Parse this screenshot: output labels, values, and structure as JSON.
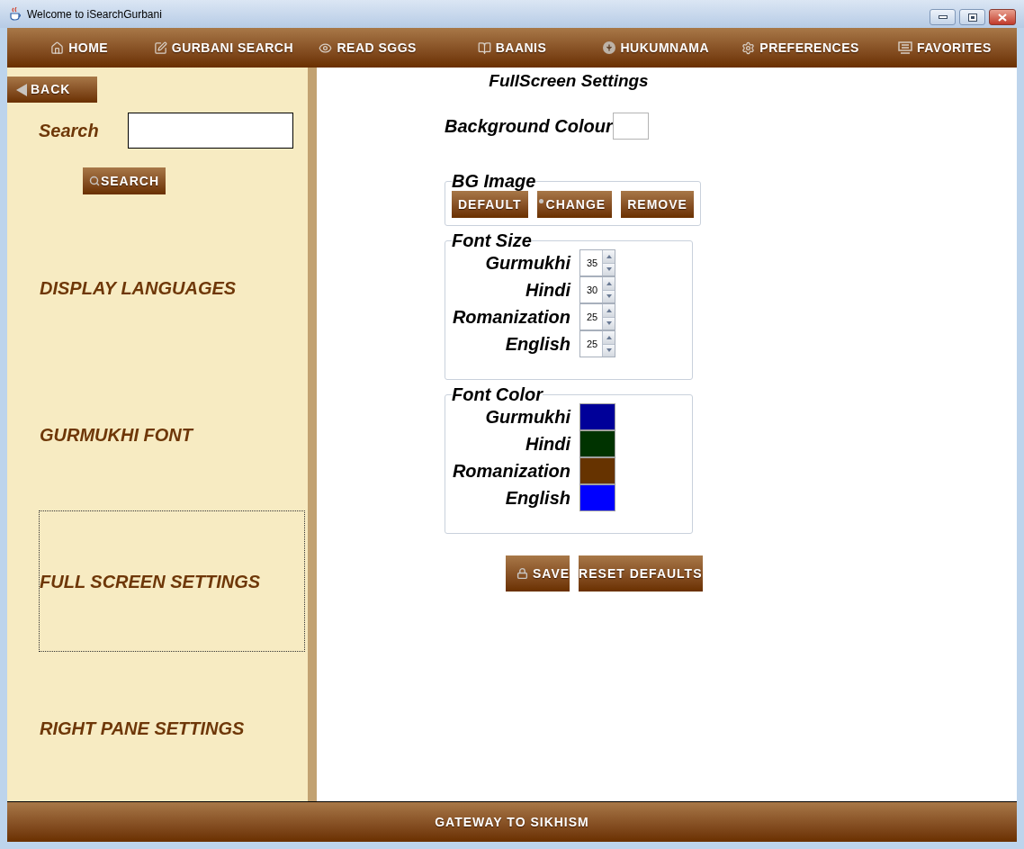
{
  "window": {
    "title": "Welcome to iSearchGurbani"
  },
  "nav": [
    {
      "label": "HOME"
    },
    {
      "label": "GURBANI SEARCH"
    },
    {
      "label": "READ SGGS"
    },
    {
      "label": "BAANIS"
    },
    {
      "label": "HUKUMNAMA"
    },
    {
      "label": "PREFERENCES"
    },
    {
      "label": "FAVORITES"
    }
  ],
  "sidebar": {
    "back_button": "BACK",
    "search": {
      "label": "Search"
    },
    "search_button": "SEARCH",
    "items": [
      {
        "label": "DISPLAY LANGUAGES",
        "selected": false
      },
      {
        "label": "GURMUKHI FONT",
        "selected": false
      },
      {
        "label": "FULL SCREEN SETTINGS",
        "selected": true
      },
      {
        "label": "RIGHT PANE SETTINGS",
        "selected": false
      }
    ]
  },
  "panel": {
    "title": "FullScreen Settings",
    "background_colour": {
      "label": "Background Colour"
    },
    "bg_image": {
      "legend": "BG Image",
      "buttons": [
        "DEFAULT",
        "CHANGE",
        "REMOVE"
      ]
    },
    "font_size": {
      "legend": "Font Size",
      "rows": [
        {
          "label": "Gurmukhi",
          "value": "35"
        },
        {
          "label": "Hindi",
          "value": "30"
        },
        {
          "label": "Romanization",
          "value": "25"
        },
        {
          "label": "English",
          "value": "25"
        }
      ]
    },
    "font_color": {
      "legend": "Font Color",
      "rows": [
        {
          "label": "Gurmukhi",
          "color": "#000099"
        },
        {
          "label": "Hindi",
          "color": "#003300"
        },
        {
          "label": "Romanization",
          "color": "#663300"
        },
        {
          "label": "English",
          "color": "#0000ff"
        }
      ]
    },
    "actions": [
      "SAVE",
      "RESET DEFAULTS"
    ]
  },
  "footer": "GATEWAY TO SIKHISM"
}
